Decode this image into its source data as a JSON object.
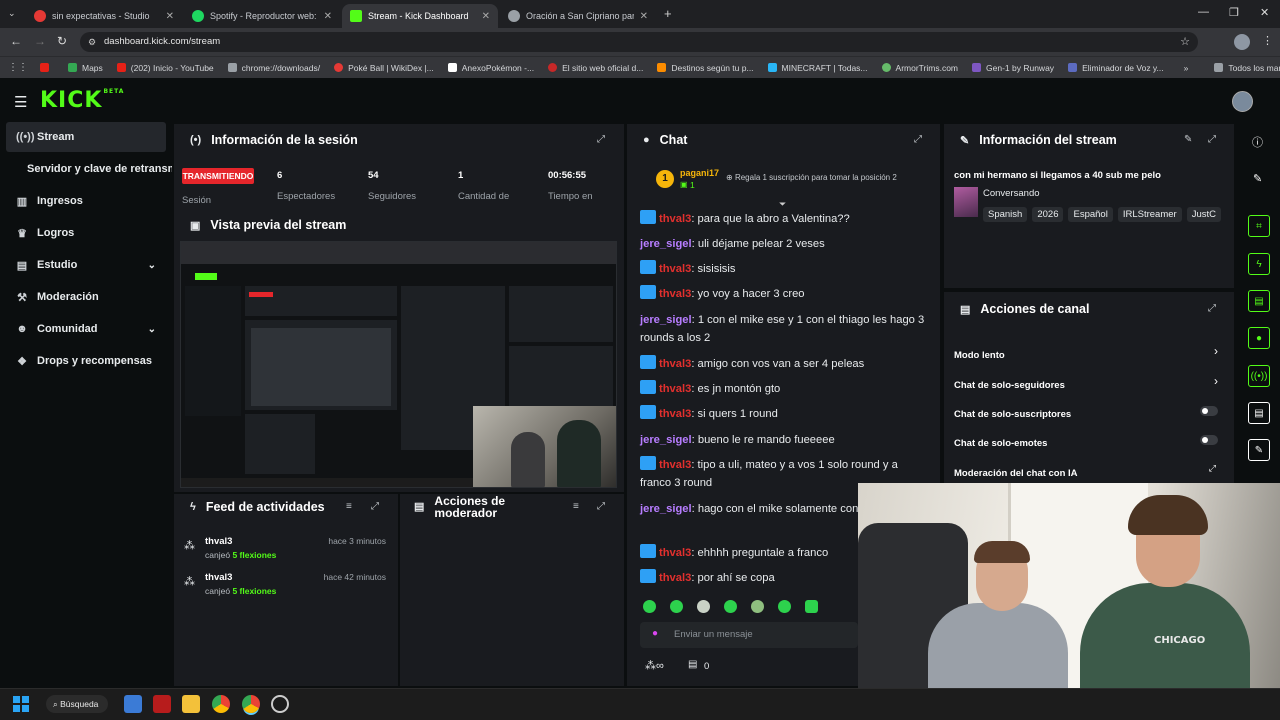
{
  "browser": {
    "tabs": [
      {
        "title": "sin expectativas - Studio",
        "icon_color": "#e53935"
      },
      {
        "title": "Spotify - Reproductor web: mú",
        "icon_color": "#1ed760"
      },
      {
        "title": "Stream - Kick Dashboard",
        "icon_color": "#53fc18"
      },
      {
        "title": "Oración a San Cipriano para At",
        "icon_color": "#9aa0a6"
      }
    ],
    "url": "dashboard.kick.com/stream",
    "bookmarks": [
      "Maps",
      "(202) Inicio - YouTube",
      "chrome://downloads/",
      "Poké Ball | WikiDex |...",
      "AnexoPokémon -...",
      "El sitio web oficial d...",
      "Destinos según tu p...",
      "MINECRAFT | Todas...",
      "ArmorTrims.com",
      "Gen-1 by Runway",
      "Eliminador de Voz y..."
    ],
    "bookmarks_folder": "Todos los marcadores"
  },
  "kick": {
    "logo": "KICK",
    "logo_badge": "BETA"
  },
  "sidebar": {
    "items": [
      {
        "label": "Stream",
        "icon": "broadcast-icon"
      },
      {
        "label": "Servidor y clave de retransmisión",
        "icon": ""
      },
      {
        "label": "Ingresos",
        "icon": "chart-icon"
      },
      {
        "label": "Logros",
        "icon": "trophy-icon"
      },
      {
        "label": "Estudio",
        "icon": "studio-icon"
      },
      {
        "label": "Moderación",
        "icon": "hammer-icon"
      },
      {
        "label": "Comunidad",
        "icon": "people-icon"
      },
      {
        "label": "Drops y recompensas",
        "icon": "gift-icon"
      }
    ]
  },
  "session": {
    "title": "Información de la sesión",
    "live_badge": "TRANSMITIENDO",
    "session_label": "Sesión",
    "stats": [
      {
        "value": "6",
        "label": "Espectadores"
      },
      {
        "value": "54",
        "label": "Seguidores"
      },
      {
        "value": "1",
        "label": "Cantidad de"
      },
      {
        "value": "00:56:55",
        "label": "Tiempo en"
      }
    ]
  },
  "preview": {
    "title": "Vista previa del stream"
  },
  "feed": {
    "title": "Feed de actividades",
    "items": [
      {
        "user": "thval3",
        "action": "canjeó",
        "reward": "5 flexiones",
        "time": "hace 3 minutos"
      },
      {
        "user": "thval3",
        "action": "canjeó",
        "reward": "5 flexiones",
        "time": "hace 42 minutos"
      }
    ]
  },
  "mod_actions": {
    "title": "Acciones de moderador"
  },
  "chat": {
    "title": "Chat",
    "top_gifter": {
      "rank": "1",
      "user": "pagani17",
      "count": "1"
    },
    "gift_prompt": "Regala 1 suscripción para tomar la posición 2",
    "messages": [
      {
        "user": "thval3",
        "text": ": para que la abro a Valentina??",
        "badge": true
      },
      {
        "user": "jere_sigel",
        "text": ": uli déjame pelear 2 veses",
        "badge": false
      },
      {
        "user": "thval3",
        "text": ": sisisisis",
        "badge": true
      },
      {
        "user": "thval3",
        "text": ": yo voy a hacer 3 creo",
        "badge": true
      },
      {
        "user": "jere_sigel",
        "text": ": 1 con el mike ese y 1 con el thiago les hago 3 rounds a los 2",
        "badge": false
      },
      {
        "user": "thval3",
        "text": ": amigo con vos van a ser 4 peleas",
        "badge": true
      },
      {
        "user": "thval3",
        "text": ": es jn montón gto",
        "badge": true
      },
      {
        "user": "thval3",
        "text": ": si quers 1 round",
        "badge": true
      },
      {
        "user": "jere_sigel",
        "text": ": bueno le re mando fueeeee",
        "badge": false
      },
      {
        "user": "thval3",
        "text": ": tipo a uli, mateo y a vos 1 solo round y a franco 3 round",
        "badge": true
      },
      {
        "user": "jere_sigel",
        "text": ": hago con el mike solamente con franco ?",
        "badge": false
      },
      {
        "user": "thval3",
        "text": ": ehhhh preguntale a franco",
        "badge": true
      },
      {
        "user": "thval3",
        "text": ": por ahí se copa",
        "badge": true
      }
    ],
    "input_placeholder": "Enviar un mensaje",
    "points": "0"
  },
  "stream_info": {
    "title": "Información del stream",
    "stream_title": "con mi hermano si llegamos a 40 sub me pelo",
    "category": "Conversando",
    "tags": [
      "Spanish",
      "2026",
      "Español",
      "IRLStreamer",
      "JustC"
    ]
  },
  "channel_actions": {
    "title": "Acciones de canal",
    "items": [
      {
        "label": "Modo lento",
        "control": "chevron"
      },
      {
        "label": "Chat de solo-seguidores",
        "control": "chevron"
      },
      {
        "label": "Chat de solo-suscriptores",
        "control": "toggle"
      },
      {
        "label": "Chat de solo-emotes",
        "control": "toggle"
      },
      {
        "label": "Moderación del chat con IA",
        "control": "external"
      }
    ]
  },
  "taskbar": {
    "search": "Búsqueda"
  },
  "colors": {
    "accent": "#53fc18",
    "panel": "#191b1f",
    "bg": "#0b0e0f",
    "live": "#e5262b",
    "user_red": "#e3302e",
    "user_purple": "#b77dff"
  }
}
